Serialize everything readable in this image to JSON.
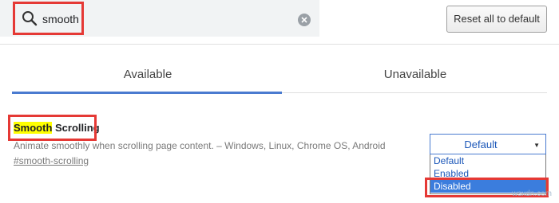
{
  "search": {
    "value": "smooth"
  },
  "toolbar": {
    "reset_label": "Reset all to default"
  },
  "tabs": [
    {
      "label": "Available",
      "active": true
    },
    {
      "label": "Unavailable",
      "active": false
    }
  ],
  "experiment": {
    "title_highlight": "Smooth",
    "title_rest": " Scrolling",
    "description": "Animate smoothly when scrolling page content. – Windows, Linux, Chrome OS, Android",
    "link": "#smooth-scrolling"
  },
  "select": {
    "value": "Default",
    "options": [
      "Default",
      "Enabled",
      "Disabled"
    ],
    "highlighted_option": "Disabled"
  },
  "watermark": "wsxdn.com",
  "colors": {
    "accent": "#4a7bd0",
    "highlight_border": "#e53935",
    "search_highlight": "#ffff00",
    "selected_option_bg": "#3b7ddd"
  }
}
